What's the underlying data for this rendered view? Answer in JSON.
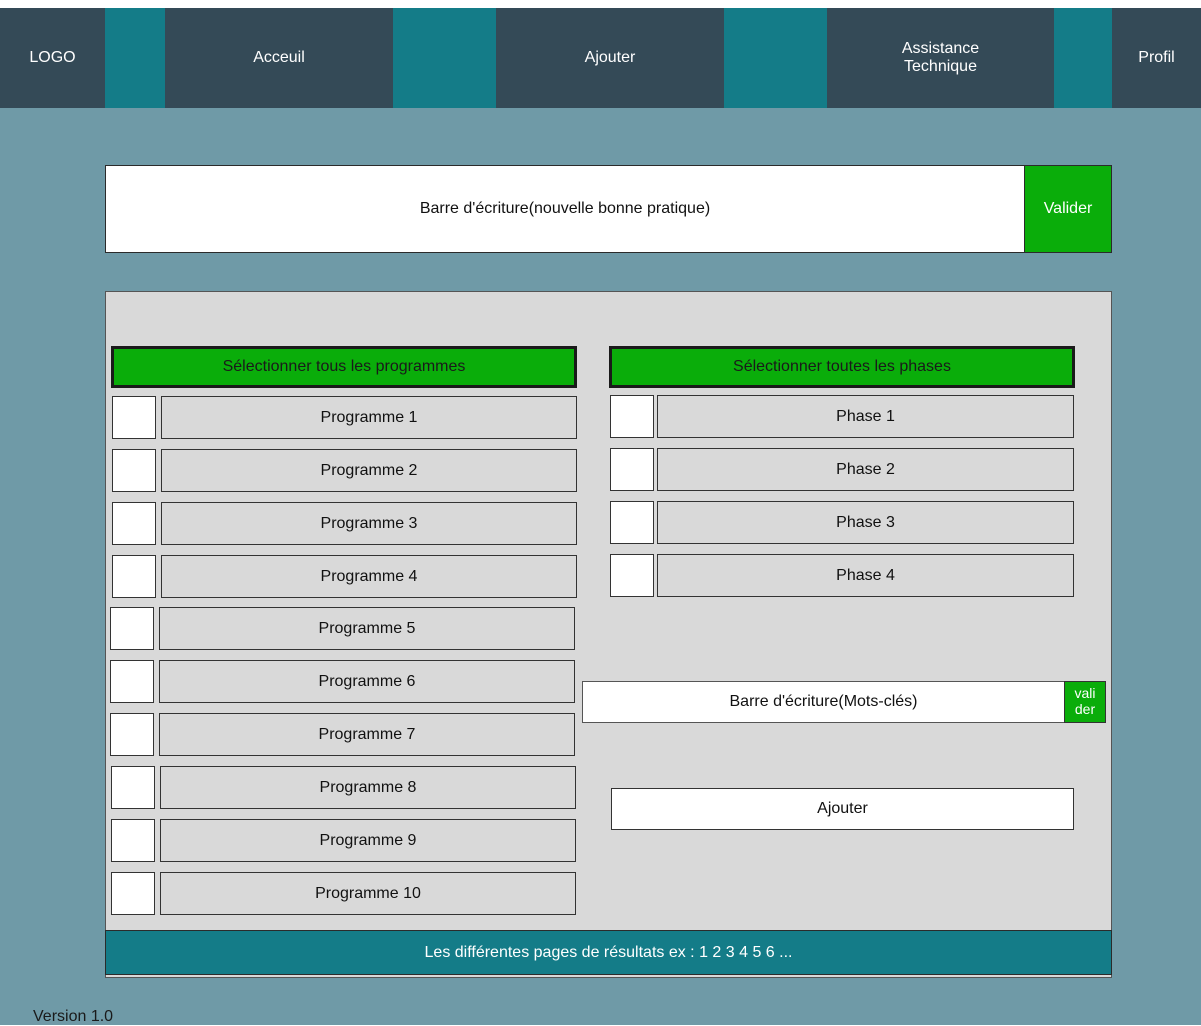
{
  "nav": {
    "logo": "LOGO",
    "home": "Acceuil",
    "add": "Ajouter",
    "support": "Assistance Technique",
    "profile": "Profil"
  },
  "new_practice": {
    "placeholder": "Barre d'écriture(nouvelle bonne pratique)",
    "submit_label": "Valider"
  },
  "programs": {
    "select_all_label": "Sélectionner tous les programmes",
    "items": [
      "Programme 1",
      "Programme 2",
      "Programme 3",
      "Programme 4",
      "Programme 5",
      "Programme 6",
      "Programme 7",
      "Programme 8",
      "Programme 9",
      "Programme 10"
    ]
  },
  "phases": {
    "select_all_label": "Sélectionner toutes les phases",
    "items": [
      "Phase 1",
      "Phase 2",
      "Phase 3",
      "Phase 4"
    ]
  },
  "keywords": {
    "placeholder": "Barre d'écriture(Mots-clés)",
    "submit_label": "vali der"
  },
  "add_button_label": "Ajouter",
  "pagination_text": "Les différentes pages de résultats ex : 1 2 3 4 5 6 ...",
  "version": "Version 1.0",
  "colors": {
    "nav_dark": "#344a57",
    "nav_teal": "#147c88",
    "background": "#6f9aa7",
    "panel": "#d9d9d9",
    "accent_green": "#0aad0a"
  }
}
